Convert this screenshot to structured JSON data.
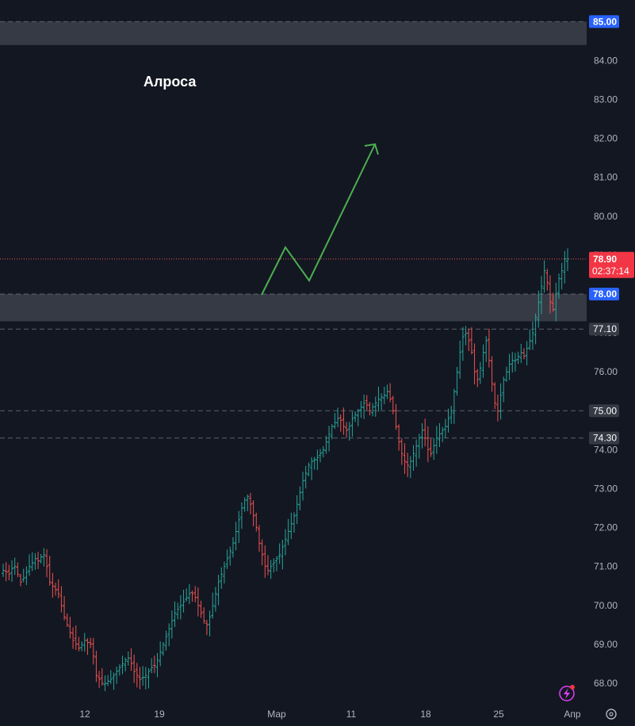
{
  "title": "Алроса",
  "colors": {
    "background": "#131722",
    "up": "#26a69a",
    "down": "#ef5350",
    "zone": "#363a45",
    "dash": "#5d606b",
    "last_price_line": "#ef5350",
    "arrow": "#4caf50",
    "blue_badge": "#2962ff",
    "red_badge": "#f23645",
    "gray_badge": "#363a45",
    "axis_text": "#b2b5be"
  },
  "icons": [
    "lightning-icon",
    "settings-icon"
  ],
  "chart_data": {
    "type": "bar",
    "ohlc_style": "bars",
    "ylim": [
      67.65,
      85.5
    ],
    "yticks": [
      "68.00",
      "69.00",
      "70.00",
      "71.00",
      "72.00",
      "73.00",
      "74.00",
      "75.00",
      "76.00",
      "77.00",
      "78.00",
      "79.00",
      "80.00",
      "81.00",
      "82.00",
      "83.00",
      "84.00",
      "85.00"
    ],
    "xticks": [
      "12",
      "19",
      "Мар",
      "11",
      "18",
      "25",
      "Апр"
    ],
    "last_price": {
      "value": 78.9,
      "label": "78.90",
      "countdown": "02:37:14"
    },
    "levels": [
      {
        "value": 85.0,
        "label": "85.00",
        "badge": "blue"
      },
      {
        "value": 78.0,
        "label": "78.00",
        "badge": "blue"
      },
      {
        "value": 77.1,
        "label": "77.10",
        "badge": "gray"
      },
      {
        "value": 75.0,
        "label": "75.00",
        "badge": "gray"
      },
      {
        "value": 74.3,
        "label": "74.30",
        "badge": "gray"
      }
    ],
    "zones": [
      {
        "from": 84.4,
        "to": 85.0
      },
      {
        "from": 77.3,
        "to": 78.0
      }
    ],
    "closes": [
      70.9,
      70.85,
      70.8,
      70.95,
      71.0,
      70.8,
      70.6,
      70.7,
      70.85,
      71.0,
      71.1,
      71.2,
      71.15,
      71.25,
      71.3,
      71.0,
      70.6,
      70.5,
      70.4,
      70.3,
      70.0,
      69.7,
      69.5,
      69.3,
      69.1,
      69.0,
      68.9,
      69.0,
      69.1,
      69.05,
      69.0,
      68.7,
      68.2,
      68.1,
      68.0,
      68.0,
      68.05,
      68.1,
      68.2,
      68.3,
      68.4,
      68.5,
      68.6,
      68.65,
      68.5,
      68.3,
      68.2,
      68.1,
      68.15,
      68.2,
      68.3,
      68.4,
      68.45,
      68.6,
      68.8,
      69.0,
      69.2,
      69.4,
      69.6,
      69.8,
      69.9,
      70.0,
      70.1,
      70.2,
      70.3,
      70.3,
      70.2,
      70.0,
      69.8,
      69.6,
      69.5,
      69.7,
      70.0,
      70.3,
      70.6,
      70.8,
      71.0,
      71.2,
      71.4,
      71.6,
      71.9,
      72.2,
      72.5,
      72.7,
      72.8,
      72.6,
      72.3,
      72.0,
      71.6,
      71.3,
      71.0,
      70.9,
      71.0,
      71.1,
      71.2,
      71.3,
      71.5,
      71.7,
      71.9,
      72.1,
      72.3,
      72.6,
      72.9,
      73.2,
      73.4,
      73.6,
      73.7,
      73.75,
      73.8,
      73.9,
      74.0,
      74.2,
      74.4,
      74.6,
      74.7,
      74.8,
      74.75,
      74.6,
      74.5,
      74.6,
      74.8,
      74.9,
      75.0,
      75.1,
      75.2,
      75.15,
      75.0,
      75.1,
      75.2,
      75.3,
      75.35,
      75.4,
      75.5,
      75.3,
      75.0,
      74.6,
      74.2,
      73.9,
      73.7,
      73.6,
      73.7,
      73.9,
      74.1,
      74.3,
      74.5,
      74.3,
      74.0,
      73.9,
      74.1,
      74.3,
      74.4,
      74.5,
      74.6,
      74.8,
      75.0,
      75.5,
      76.0,
      76.5,
      76.9,
      77.0,
      76.8,
      76.5,
      76.0,
      75.8,
      76.1,
      76.5,
      76.8,
      76.3,
      75.7,
      75.2,
      75.0,
      75.4,
      75.8,
      76.0,
      76.2,
      76.3,
      76.3,
      76.4,
      76.5,
      76.4,
      76.6,
      76.8,
      77.0,
      77.4,
      77.8,
      78.2,
      78.6,
      78.3,
      77.8,
      77.6,
      78.0,
      78.4,
      78.6,
      78.9,
      78.9
    ]
  }
}
